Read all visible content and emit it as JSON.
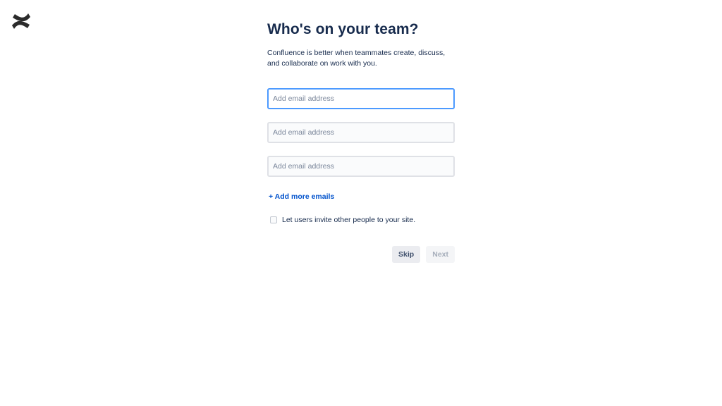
{
  "app": {
    "logo_icon": "confluence-logo-icon"
  },
  "page": {
    "title": "Who's on your team?",
    "description_line1": "Confluence is better when teammates create, discuss,",
    "description_line2": "and collaborate on work with you."
  },
  "emails": {
    "fields": [
      {
        "value": "",
        "placeholder": "Add email address",
        "focused": true
      },
      {
        "value": "",
        "placeholder": "Add email address",
        "focused": false
      },
      {
        "value": "",
        "placeholder": "Add email address",
        "focused": false
      }
    ],
    "add_more_label": "+ Add more emails"
  },
  "invite_option": {
    "label": "Let users invite other people to your site.",
    "checked": false
  },
  "actions": {
    "skip_label": "Skip",
    "next_label": "Next",
    "next_disabled": true
  },
  "colors": {
    "primary_text": "#172b4d",
    "link": "#0052cc",
    "focus_border": "#4c9aff"
  }
}
